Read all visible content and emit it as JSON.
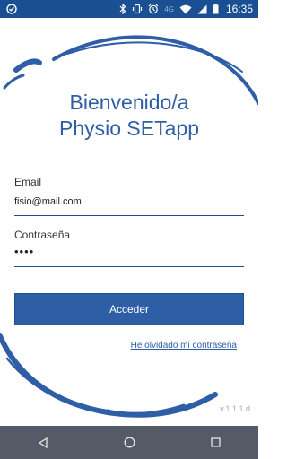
{
  "status_bar": {
    "network_label": "4G",
    "time": "16:35",
    "icons": [
      "notification-icon",
      "bluetooth-icon",
      "vibrate-icon",
      "alarm-icon",
      "wifi-icon",
      "signal-icon",
      "battery-icon"
    ]
  },
  "header": {
    "line1": "Bienvenido/a",
    "line2": "Physio SETapp"
  },
  "form": {
    "email_label": "Email",
    "email_value": "fisio@mail.com",
    "password_label": "Contraseña",
    "password_value": "••••",
    "submit_label": "Acceder",
    "forgot_label": "He olvidado mi contraseña"
  },
  "footer": {
    "version": "v.1.1.1.d"
  },
  "nav_bar": {
    "icons": [
      "back-icon",
      "home-icon",
      "recents-icon"
    ]
  },
  "colors": {
    "brand_blue": "#2e5ea6",
    "status_bar": "#1b4f93",
    "nav_bar": "#555b66"
  }
}
